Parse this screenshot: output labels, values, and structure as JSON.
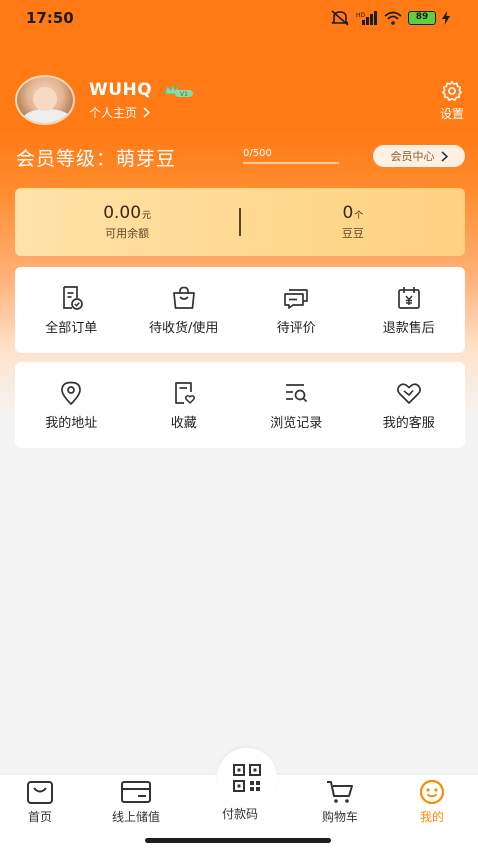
{
  "status_bar": {
    "time": "17:50",
    "battery": "89",
    "icons": [
      "mute-icon",
      "hd-signal-icon",
      "wifi-icon",
      "battery-icon",
      "charging-icon"
    ]
  },
  "profile": {
    "username": "WUHQ",
    "vip_badge": "V1",
    "homepage_label": "个人主页",
    "settings_label": "设置"
  },
  "membership": {
    "level_text": "会员等级：萌芽豆",
    "progress_text": "0/500",
    "progress_value": 0,
    "progress_max": 500,
    "center_button": "会员中心"
  },
  "balance": {
    "amount": "0.00",
    "amount_unit": "元",
    "amount_label": "可用余额",
    "beans": "0",
    "beans_unit": "个",
    "beans_label": "豆豆"
  },
  "orders": [
    {
      "label": "全部订单",
      "icon": "order-list-icon"
    },
    {
      "label": "待收货/使用",
      "icon": "shopping-bag-icon"
    },
    {
      "label": "待评价",
      "icon": "comment-icon"
    },
    {
      "label": "退款售后",
      "icon": "refund-icon"
    }
  ],
  "services": [
    {
      "label": "我的地址",
      "icon": "location-pin-icon"
    },
    {
      "label": "收藏",
      "icon": "favorite-icon"
    },
    {
      "label": "浏览记录",
      "icon": "history-search-icon"
    },
    {
      "label": "我的客服",
      "icon": "customer-service-icon"
    }
  ],
  "bottom_nav": {
    "home": "首页",
    "topup": "线上储值",
    "paycode": "付款码",
    "cart": "购物车",
    "mine": "我的"
  },
  "colors": {
    "brand_orange": "#ff7a14",
    "active_nav": "#ff8a00",
    "balance_card": "#ffd88f"
  }
}
